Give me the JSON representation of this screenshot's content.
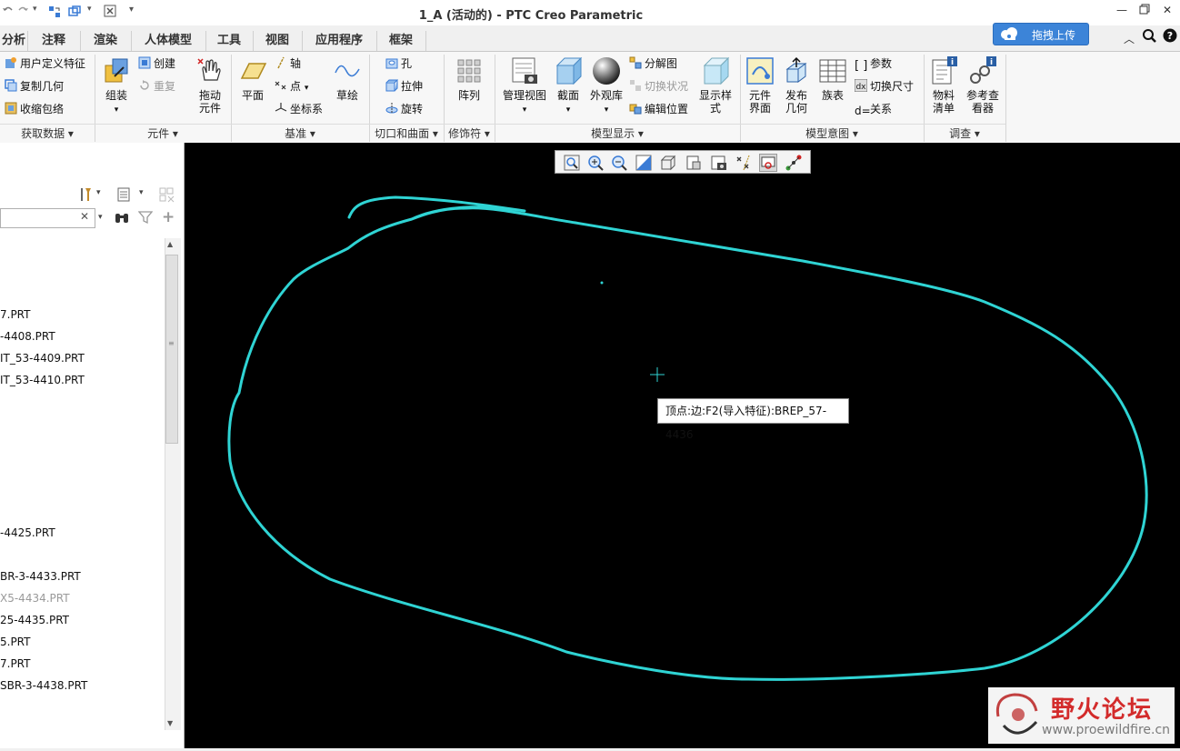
{
  "window": {
    "title": "1_A (活动的) - PTC Creo Parametric"
  },
  "upload_button": {
    "label": "拖拽上传"
  },
  "tabs": [
    "分析",
    "注释",
    "渲染",
    "人体模型",
    "工具",
    "视图",
    "应用程序",
    "框架"
  ],
  "ribbon": {
    "get_data": {
      "label": "获取数据",
      "items": [
        "用户定义特征",
        "复制几何",
        "收缩包络"
      ]
    },
    "component": {
      "label": "元件",
      "assemble": "组装",
      "create": "创建",
      "repeat": "重复",
      "drag": "拖动\n元件"
    },
    "datum": {
      "label": "基准",
      "plane": "平面",
      "axis": "轴",
      "point": "点",
      "csys": "坐标系",
      "sketch": "草绘"
    },
    "cut_surface": {
      "label": "切口和曲面",
      "hole": "孔",
      "extrude": "拉伸",
      "revolve": "旋转"
    },
    "modifiers": {
      "label": "修饰符",
      "pattern": "阵列"
    },
    "model_display": {
      "label": "模型显示",
      "manage_views": "管理视图",
      "section": "截面",
      "appearance": "外观库",
      "exploded": "分解图",
      "toggle_status": "切换状况",
      "edit_position": "编辑位置",
      "display_style": "显示样\n式"
    },
    "model_intent": {
      "label": "模型意图",
      "component_interface": "元件\n界面",
      "publish_geometry": "发布\n几何",
      "family_table": "族表",
      "parameters": "参数",
      "switch_dims": "切换尺寸",
      "relations": "关系"
    },
    "investigate": {
      "label": "调查",
      "bom": "物料\n清单",
      "ref_viewer": "参考查\n看器"
    }
  },
  "model_tree": {
    "items": [
      {
        "text": "7.PRT",
        "disabled": false
      },
      {
        "text": "-4408.PRT",
        "disabled": false
      },
      {
        "text": "IT_53-4409.PRT",
        "disabled": false
      },
      {
        "text": "IT_53-4410.PRT",
        "disabled": false
      },
      {
        "text": "-4425.PRT",
        "disabled": false
      },
      {
        "text": "BR-3-4433.PRT",
        "disabled": false
      },
      {
        "text": "X5-4434.PRT",
        "disabled": true
      },
      {
        "text": "25-4435.PRT",
        "disabled": false
      },
      {
        "text": "5.PRT",
        "disabled": false
      },
      {
        "text": "7.PRT",
        "disabled": false
      },
      {
        "text": "SBR-3-4438.PRT",
        "disabled": false
      }
    ]
  },
  "viewport": {
    "tooltip": "顶点:边:F2(导入特征):BREP_57-4436",
    "curve_color": "#2fd4d4"
  },
  "watermark": {
    "title": "野火论坛",
    "url": "www.proewildfire.cn"
  }
}
